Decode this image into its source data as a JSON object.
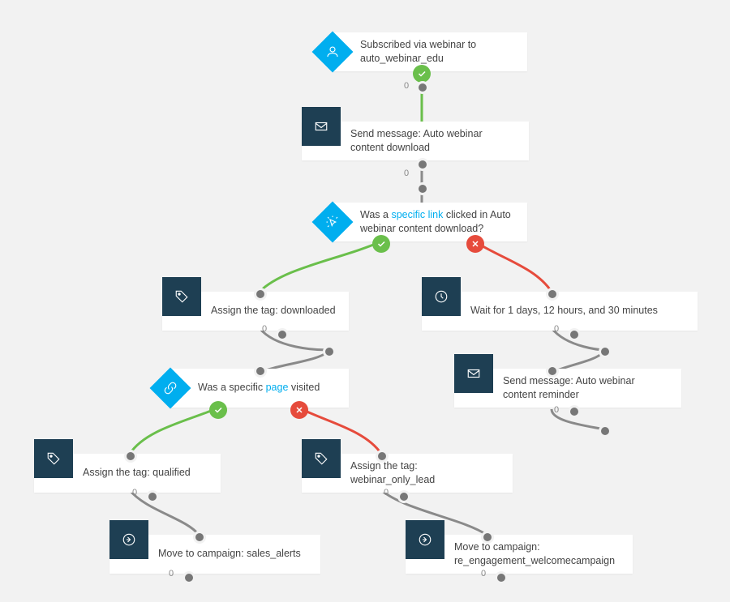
{
  "nodes": {
    "start": {
      "text": "Subscribed via webinar to auto_webinar_edu"
    },
    "send1": {
      "text": "Send message: Auto webinar content download"
    },
    "cond_link": {
      "prefix": "Was a ",
      "link": "specific link",
      "suffix": " clicked in Auto webinar content download?"
    },
    "tag_downloaded": {
      "text": "Assign the tag: downloaded"
    },
    "wait": {
      "text": "Wait for 1 days, 12 hours, and 30 minutes"
    },
    "cond_page": {
      "prefix": "Was a specific ",
      "link": "page",
      "suffix": " visited"
    },
    "send2": {
      "text": "Send message: Auto webinar content reminder"
    },
    "tag_qualified": {
      "text": "Assign the tag: qualified"
    },
    "tag_webinar_lead": {
      "text": "Assign the tag: webinar_only_lead"
    },
    "move_sales": {
      "text": "Move to campaign: sales_alerts"
    },
    "move_reeng": {
      "text": "Move to campaign: re_engagement_welcomecampaign"
    }
  },
  "zero": "0"
}
